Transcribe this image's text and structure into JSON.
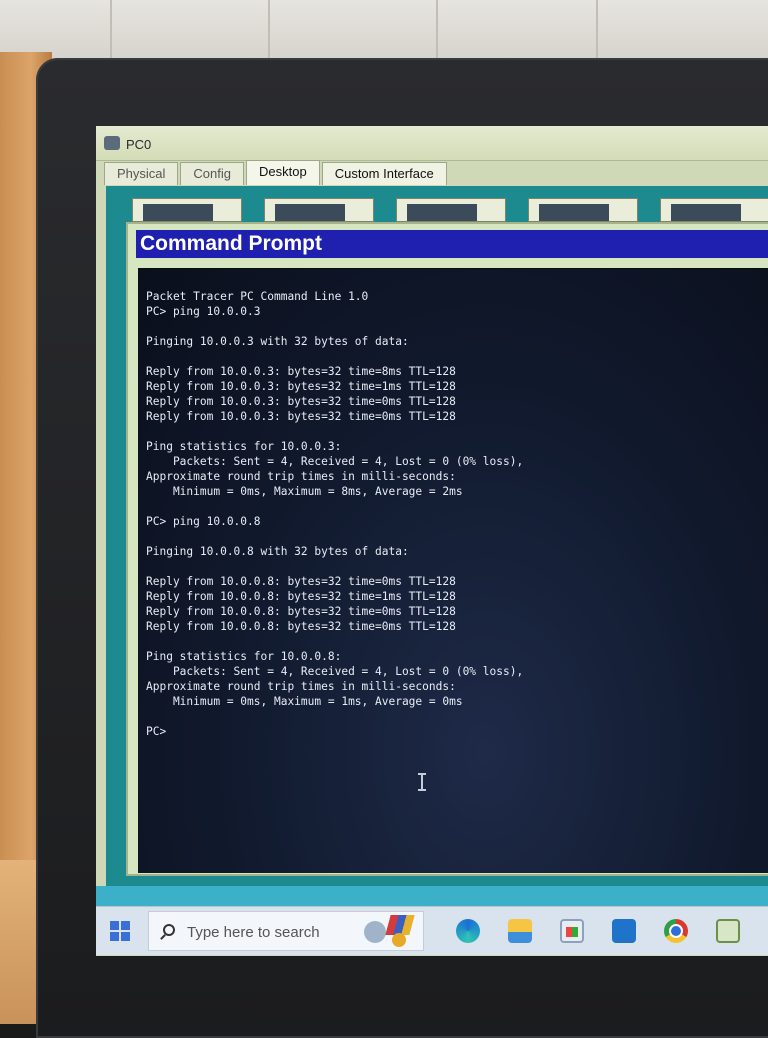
{
  "packet_tracer": {
    "window_title": "PC0",
    "tabs": [
      {
        "label": "Physical"
      },
      {
        "label": "Config"
      },
      {
        "label": "Desktop"
      },
      {
        "label": "Custom Interface"
      }
    ],
    "active_tab": "Desktop"
  },
  "command_prompt": {
    "title": "Command Prompt",
    "lines": [
      "Packet Tracer PC Command Line 1.0",
      "PC> ping 10.0.0.3",
      "",
      "Pinging 10.0.0.3 with 32 bytes of data:",
      "",
      "Reply from 10.0.0.3: bytes=32 time=8ms TTL=128",
      "Reply from 10.0.0.3: bytes=32 time=1ms TTL=128",
      "Reply from 10.0.0.3: bytes=32 time=0ms TTL=128",
      "Reply from 10.0.0.3: bytes=32 time=0ms TTL=128",
      "",
      "Ping statistics for 10.0.0.3:",
      "    Packets: Sent = 4, Received = 4, Lost = 0 (0% loss),",
      "Approximate round trip times in milli-seconds:",
      "    Minimum = 0ms, Maximum = 8ms, Average = 2ms",
      "",
      "PC> ping 10.0.0.8",
      "",
      "Pinging 10.0.0.8 with 32 bytes of data:",
      "",
      "Reply from 10.0.0.8: bytes=32 time=0ms TTL=128",
      "Reply from 10.0.0.8: bytes=32 time=1ms TTL=128",
      "Reply from 10.0.0.8: bytes=32 time=0ms TTL=128",
      "Reply from 10.0.0.8: bytes=32 time=0ms TTL=128",
      "",
      "Ping statistics for 10.0.0.8:",
      "    Packets: Sent = 4, Received = 4, Lost = 0 (0% loss),",
      "Approximate round trip times in milli-seconds:",
      "    Minimum = 0ms, Maximum = 1ms, Average = 0ms",
      "",
      "PC>"
    ]
  },
  "taskbar": {
    "search_placeholder": "Type here to search",
    "icons": [
      "start-icon",
      "search-icon",
      "edge-icon",
      "file-explorer-icon",
      "store-icon",
      "mail-icon",
      "chrome-icon",
      "packet-tracer-icon"
    ]
  },
  "colors": {
    "cmd_title_bar": "#1f1fb0",
    "terminal_bg": "#111a2e",
    "terminal_text": "#e8ecf6"
  }
}
